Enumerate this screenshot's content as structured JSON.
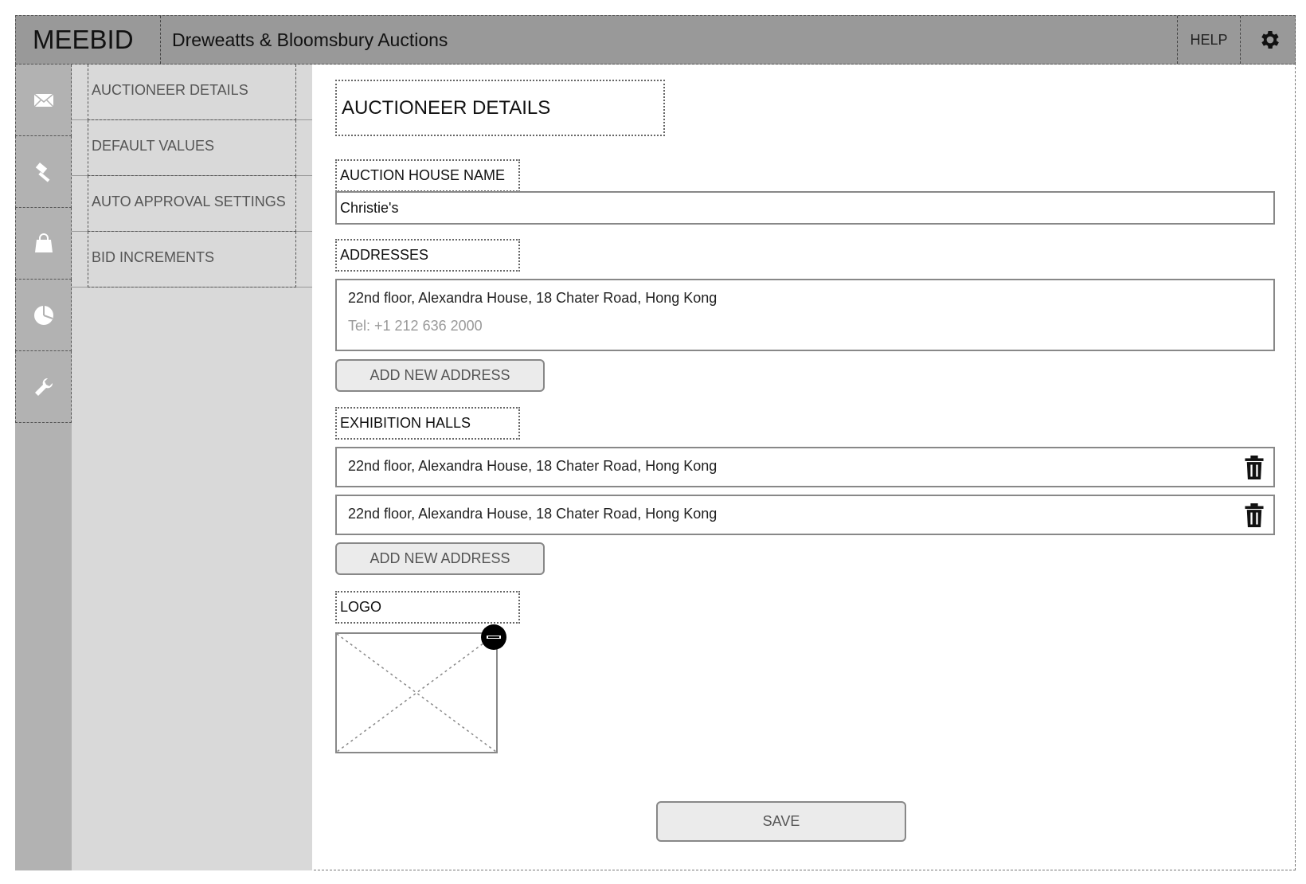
{
  "header": {
    "brand": "MEEBID",
    "company": "Dreweatts & Bloomsbury Auctions",
    "help_label": "HELP",
    "settings_icon": "gear-icon"
  },
  "iconbar": {
    "items": [
      {
        "icon": "envelope-icon"
      },
      {
        "icon": "gavel-icon"
      },
      {
        "icon": "shopping-bag-icon"
      },
      {
        "icon": "pie-chart-icon"
      },
      {
        "icon": "wrench-icon"
      }
    ]
  },
  "subnav": {
    "items": [
      {
        "label": "AUCTIONEER DETAILS"
      },
      {
        "label": "DEFAULT VALUES"
      },
      {
        "label": "AUTO APPROVAL SETTINGS"
      },
      {
        "label": "BID INCREMENTS"
      }
    ]
  },
  "main": {
    "title": "AUCTIONEER DETAILS",
    "auction_house": {
      "label": "AUCTION HOUSE NAME",
      "value": "Christie's"
    },
    "addresses": {
      "label": "ADDRESSES",
      "line1": "22nd floor, Alexandra House, 18 Chater Road, Hong Kong",
      "line2": "Tel: +1 212 636 2000",
      "add_button": "ADD NEW ADDRESS"
    },
    "exhibition_halls": {
      "label": "EXHIBITION HALLS",
      "items": [
        {
          "text": "22nd floor, Alexandra House, 18 Chater Road, Hong Kong"
        },
        {
          "text": "22nd floor, Alexandra House, 18 Chater Road, Hong Kong"
        }
      ],
      "add_button": "ADD NEW ADDRESS"
    },
    "logo": {
      "label": "LOGO"
    },
    "save_button": "SAVE"
  }
}
